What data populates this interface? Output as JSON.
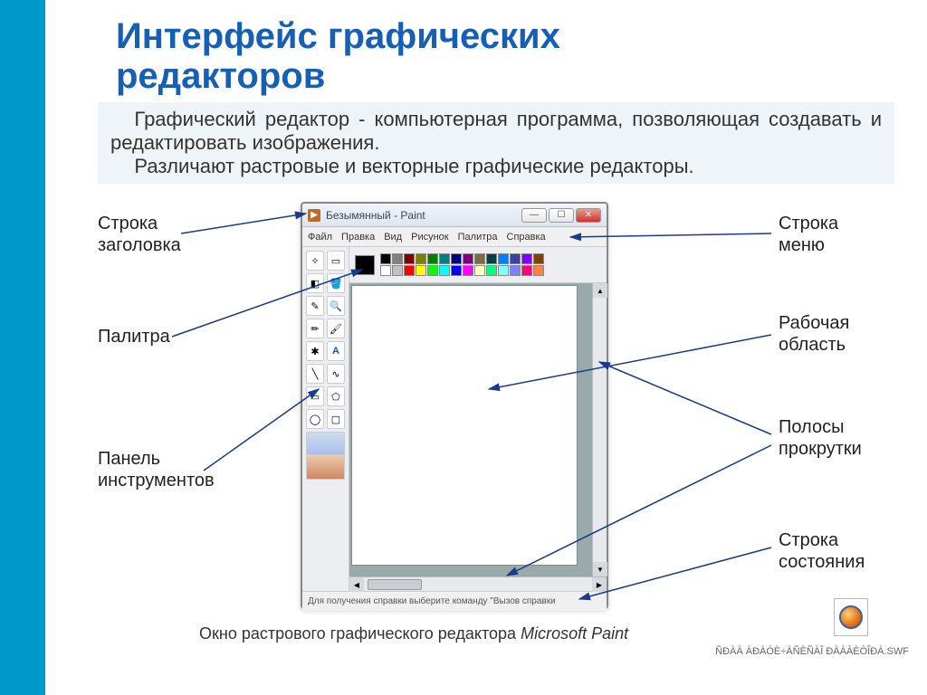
{
  "title_line1": "Интерфейс графических",
  "title_line2": "редакторов",
  "description_p1": "Графический редактор - компьютерная программа, позволяющая создавать и редактировать изображения.",
  "description_p2": "Различают растровые и векторные графические редакторы.",
  "labels": {
    "titlebar": "Строка заголовка",
    "palette": "Палитра",
    "toolbar": "Панель инструментов",
    "menubar": "Строка меню",
    "workarea": "Рабочая область",
    "scrollbars": "Полосы прокрутки",
    "statusbar": "Строка состояния"
  },
  "paint": {
    "title": "Безымянный - Paint",
    "menu": [
      "Файл",
      "Правка",
      "Вид",
      "Рисунок",
      "Палитра",
      "Справка"
    ],
    "status_text": "Для получения справки выберите команду \"Вызов справки",
    "palette_colors_row1": [
      "#000000",
      "#808080",
      "#800000",
      "#808000",
      "#008000",
      "#008080",
      "#000080",
      "#800080",
      "#806b49",
      "#004040",
      "#0080ff",
      "#4040a0",
      "#8000ff",
      "#804000"
    ],
    "palette_colors_row2": [
      "#ffffff",
      "#c0c0c0",
      "#ff0000",
      "#ffff00",
      "#00ff00",
      "#00ffff",
      "#0000ff",
      "#ff00ff",
      "#ffffc0",
      "#00ff80",
      "#80ffff",
      "#8080ff",
      "#ff0080",
      "#ff8040"
    ]
  },
  "caption_prefix": "Окно растрового графического редактора ",
  "caption_em": "Microsoft Paint",
  "file_label": "ÑÐÀÀ ÀÐÀÒÈ÷ÀÑÈÑÀÎ ÐÀÀÀÈÒÎÐÀ.SWF"
}
